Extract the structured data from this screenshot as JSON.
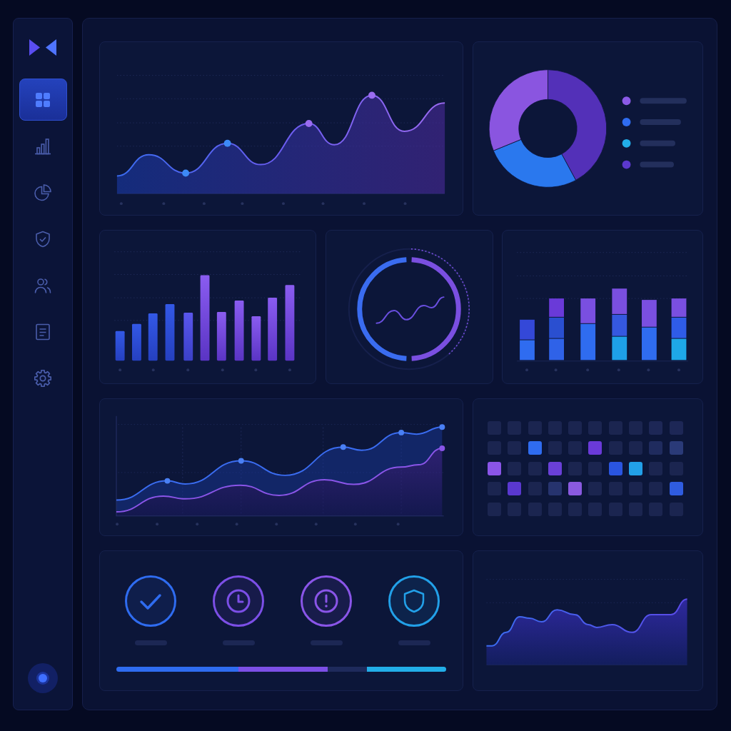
{
  "sidebar": {
    "items": [
      {
        "kind": "grid",
        "selected": true
      },
      {
        "kind": "bar-chart",
        "selected": false
      },
      {
        "kind": "pie-chart",
        "selected": false
      },
      {
        "kind": "shield",
        "selected": false
      },
      {
        "kind": "users",
        "selected": false
      },
      {
        "kind": "document",
        "selected": false
      },
      {
        "kind": "settings",
        "selected": false
      }
    ]
  },
  "donut_card": {
    "legend": [
      {
        "color": "#8b5ae6"
      },
      {
        "color": "#2f6cf0"
      },
      {
        "color": "#22aee8"
      },
      {
        "color": "#5b38cc"
      }
    ]
  },
  "heatmap": {
    "rows": [
      {
        "cells": [
          {
            "color": "#1b2550"
          },
          {
            "color": "#1b2550"
          },
          {
            "color": "#1b2550"
          },
          {
            "color": "#1b2550"
          },
          {
            "color": "#1b2550"
          },
          {
            "color": "#1b2550"
          },
          {
            "color": "#1b2550"
          },
          {
            "color": "#1b2550"
          },
          {
            "color": "#1d2756"
          },
          {
            "color": "#1d2756"
          }
        ]
      },
      {
        "cells": [
          {
            "color": "#1b2550"
          },
          {
            "color": "#1b2550"
          },
          {
            "color": "#2f6cf0"
          },
          {
            "color": "#1b2550"
          },
          {
            "color": "#1b2550"
          },
          {
            "color": "#6a3ad8"
          },
          {
            "color": "#1b2550"
          },
          {
            "color": "#1b2550"
          },
          {
            "color": "#1f2b5e"
          },
          {
            "color": "#2a3a78"
          }
        ]
      },
      {
        "cells": [
          {
            "color": "#8a55e8"
          },
          {
            "color": "#1b2550"
          },
          {
            "color": "#1b2550"
          },
          {
            "color": "#6a40d8"
          },
          {
            "color": "#1b2550"
          },
          {
            "color": "#1b2550"
          },
          {
            "color": "#2a55e0"
          },
          {
            "color": "#22a0e8"
          },
          {
            "color": "#1b2550"
          },
          {
            "color": "#1b2550"
          }
        ]
      },
      {
        "cells": [
          {
            "color": "#1b2550"
          },
          {
            "color": "#5a38d0"
          },
          {
            "color": "#1b2550"
          },
          {
            "color": "#26336e"
          },
          {
            "color": "#8a5ae0"
          },
          {
            "color": "#1b2550"
          },
          {
            "color": "#1b2550"
          },
          {
            "color": "#1b2550"
          },
          {
            "color": "#1b2550"
          },
          {
            "color": "#2f5ce0"
          }
        ]
      },
      {
        "cells": [
          {
            "color": "#1b2550"
          },
          {
            "color": "#1b2550"
          },
          {
            "color": "#1b2550"
          },
          {
            "color": "#1b2550"
          },
          {
            "color": "#1b2550"
          },
          {
            "color": "#1b2550"
          },
          {
            "color": "#1b2550"
          },
          {
            "color": "#1b2550"
          },
          {
            "color": "#1b2550"
          },
          {
            "color": "#1b2550"
          }
        ]
      }
    ]
  },
  "status_card": {
    "items": [
      {
        "kind": "check",
        "color": "#2f6cf0"
      },
      {
        "kind": "clock",
        "color": "#7c4fe6"
      },
      {
        "kind": "alert",
        "color": "#8a55e8"
      },
      {
        "kind": "shield",
        "color": "#22a0e8"
      }
    ]
  }
}
